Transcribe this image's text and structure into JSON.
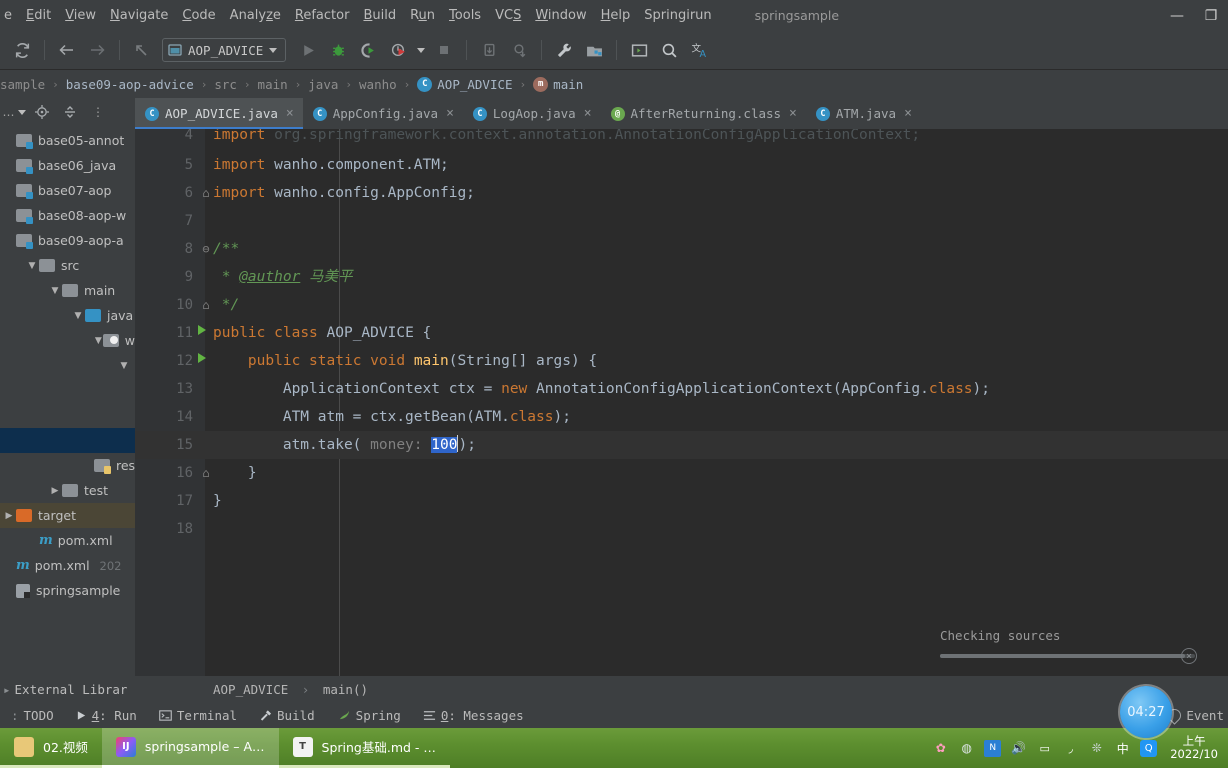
{
  "menubar": {
    "items": [
      {
        "label": "e",
        "mnemonic": ""
      },
      {
        "label": "Edit",
        "mnemonic": "E"
      },
      {
        "label": "View",
        "mnemonic": "V"
      },
      {
        "label": "Navigate",
        "mnemonic": "N"
      },
      {
        "label": "Code",
        "mnemonic": "C"
      },
      {
        "label": "Analyze",
        "mnemonic": "z"
      },
      {
        "label": "Refactor",
        "mnemonic": "R"
      },
      {
        "label": "Build",
        "mnemonic": "B"
      },
      {
        "label": "Run",
        "mnemonic": "u"
      },
      {
        "label": "Tools",
        "mnemonic": "T"
      },
      {
        "label": "VCS",
        "mnemonic": "S"
      },
      {
        "label": "Window",
        "mnemonic": "W"
      },
      {
        "label": "Help",
        "mnemonic": "H"
      },
      {
        "label": "Springirun",
        "mnemonic": ""
      }
    ],
    "window_title": "springsample",
    "minimize": "—",
    "restore": "❐"
  },
  "toolbar": {
    "sync_icon": "sync-icon",
    "back_icon": "back-arrow-icon",
    "forward_icon": "forward-arrow-icon",
    "up_icon": "navigate-up-icon",
    "run_config_label": "AOP_ADVICE",
    "run_icon": "run-icon",
    "debug_icon": "debug-icon",
    "run_coverage_icon": "run-with-coverage-icon",
    "profile_icon": "profiler-icon",
    "stop_icon": "stop-icon",
    "update_icon": "update-project-icon",
    "commit_icon": "commit-icon",
    "settings_icon": "wrench-settings-icon",
    "project_structure_icon": "project-structure-icon",
    "terminal_icon": "terminal-icon",
    "search_icon": "search-everywhere-icon",
    "translate_icon": "translate-icon"
  },
  "breadcrumb": {
    "items": [
      "sample",
      "base09-aop-advice",
      "src",
      "main",
      "java",
      "wanho",
      "AOP_ADVICE",
      "main"
    ],
    "class_badge": "C",
    "method_badge": "m",
    "separator": "›"
  },
  "project": {
    "header": {
      "title_ellipsis": "…",
      "locate_icon": "locate-icon",
      "collapse_icon": "collapse-all-icon",
      "settings_icon": "options-icon"
    },
    "tree": [
      {
        "indent": 0,
        "arrow": "",
        "icon": "module-folder",
        "label": "base05-annot",
        "sel": false
      },
      {
        "indent": 0,
        "arrow": "",
        "icon": "module-folder",
        "label": "base06_java",
        "sel": false
      },
      {
        "indent": 0,
        "arrow": "",
        "icon": "module-folder",
        "label": "base07-aop",
        "sel": false
      },
      {
        "indent": 0,
        "arrow": "",
        "icon": "module-folder",
        "label": "base08-aop-w",
        "sel": false
      },
      {
        "indent": 0,
        "arrow": "",
        "icon": "module-folder",
        "label": "base09-aop-a",
        "sel": false
      },
      {
        "indent": 1,
        "arrow": "▼",
        "icon": "folder",
        "label": "src",
        "sel": false
      },
      {
        "indent": 2,
        "arrow": "▼",
        "icon": "folder",
        "label": "main",
        "sel": false
      },
      {
        "indent": 3,
        "arrow": "▼",
        "icon": "source-folder",
        "label": "java",
        "sel": false
      },
      {
        "indent": 4,
        "arrow": "▼",
        "icon": "package",
        "label": "w",
        "sel": false
      },
      {
        "indent": 5,
        "arrow": "▼",
        "icon": "",
        "label": "",
        "sel": false
      },
      {
        "indent": 6,
        "arrow": "",
        "icon": "",
        "label": "",
        "sel": false
      },
      {
        "indent": 6,
        "arrow": "▼",
        "icon": "",
        "label": "",
        "sel": false
      },
      {
        "indent": 6,
        "arrow": "",
        "icon": "",
        "label": "",
        "sel": true
      },
      {
        "indent": 4,
        "arrow": "",
        "icon": "resource-folder",
        "label": "reso",
        "sel": false
      },
      {
        "indent": 2,
        "arrow": "▶",
        "icon": "folder",
        "label": "test",
        "sel": false
      },
      {
        "indent": 0,
        "arrow": "▶",
        "icon": "target-folder",
        "label": "target",
        "sel": false,
        "hl": true
      },
      {
        "indent": 1,
        "arrow": "",
        "icon": "maven",
        "label": "pom.xml",
        "sel": false
      },
      {
        "indent": 0,
        "arrow": "",
        "icon": "maven",
        "label": "pom.xml",
        "extra": "202",
        "sel": false
      },
      {
        "indent": 0,
        "arrow": "",
        "icon": "module",
        "label": "springsample",
        "sel": false
      }
    ],
    "external_libraries": "External Librar"
  },
  "tabs": [
    {
      "label": "AOP_ADVICE.java",
      "icon": "class-icon",
      "badge": "C",
      "active": true,
      "close": "×"
    },
    {
      "label": "AppConfig.java",
      "icon": "class-icon",
      "badge": "C",
      "active": false,
      "close": "×"
    },
    {
      "label": "LogAop.java",
      "icon": "class-icon",
      "badge": "C",
      "active": false,
      "close": "×"
    },
    {
      "label": "AfterReturning.class",
      "icon": "annotation-icon",
      "badge": "@",
      "active": false,
      "close": "×"
    },
    {
      "label": "ATM.java",
      "icon": "class-icon",
      "badge": "C",
      "active": false,
      "close": "×"
    }
  ],
  "editor": {
    "lines": [
      {
        "n": "4",
        "clipped": true,
        "raw": "import org.springframework.context.annotation.AnnotationConfigApplicationContext;"
      },
      {
        "n": "5",
        "raw": "import wanho.component.ATM;"
      },
      {
        "n": "6",
        "raw": "import wanho.config.AppConfig;",
        "fold": "⌂"
      },
      {
        "n": "7",
        "raw": ""
      },
      {
        "n": "8",
        "raw": "/**",
        "fold": "⊖"
      },
      {
        "n": "9",
        "raw": " * @author 马美平"
      },
      {
        "n": "10",
        "raw": " */",
        "fold": "⌂"
      },
      {
        "n": "11",
        "raw": "public class AOP_ADVICE {",
        "run": true
      },
      {
        "n": "12",
        "raw": "    public static void main(String[] args) {",
        "run": true,
        "fold": "⊖"
      },
      {
        "n": "13",
        "raw": "        ApplicationContext ctx = new AnnotationConfigApplicationContext(AppConfig.class);"
      },
      {
        "n": "14",
        "raw": "        ATM atm = ctx.getBean(ATM.class);"
      },
      {
        "n": "15",
        "raw": "        atm.take( money: 100);",
        "current": true
      },
      {
        "n": "16",
        "raw": "    }",
        "fold": "⌂"
      },
      {
        "n": "17",
        "raw": "}"
      },
      {
        "n": "18",
        "raw": ""
      }
    ],
    "selected_text": "100",
    "hint_param": "money:",
    "progress_label": "Checking sources",
    "progress_percent": 96,
    "progress_cancel": "×"
  },
  "navbar": {
    "external_libraries": "External Librar",
    "path_class": "AOP_ADVICE",
    "path_sep": "›",
    "path_method": "main()"
  },
  "statusbar": {
    "items": [
      {
        "label": "TODO",
        "icon": "todo-icon",
        "prefix": ":"
      },
      {
        "label": "4: Run",
        "icon": "run-icon",
        "underline": "4"
      },
      {
        "label": "Terminal",
        "icon": "terminal-icon"
      },
      {
        "label": "Build",
        "icon": "build-hammer-icon"
      },
      {
        "label": "Spring",
        "icon": "spring-leaf-icon"
      },
      {
        "label": "0: Messages",
        "icon": "messages-icon",
        "underline": "0"
      }
    ]
  },
  "clock_widget": {
    "time": "04:27"
  },
  "event_log": {
    "label": "Event",
    "icon": "notification-bell-icon"
  },
  "taskbar": {
    "tasks": [
      {
        "label": "02.视频",
        "icon": "folder-icon",
        "icon_color": "#e8c878",
        "active": false
      },
      {
        "label": "springsample – A…",
        "icon": "intellij-idea-icon",
        "icon_color": "#f0436b",
        "active": true
      },
      {
        "label": "Spring基础.md - …",
        "icon": "typora-icon",
        "icon_color": "#ffffff",
        "active": false
      }
    ],
    "tray_icons": [
      "flower-icon",
      "globe-icon",
      "onenote-icon",
      "volume-icon",
      "battery-icon",
      "wifi-icon",
      "nvidia-icon",
      "ime-chinese-icon",
      "qq-icon"
    ],
    "clock_ampm": "上午",
    "clock_date": "2022/10"
  }
}
